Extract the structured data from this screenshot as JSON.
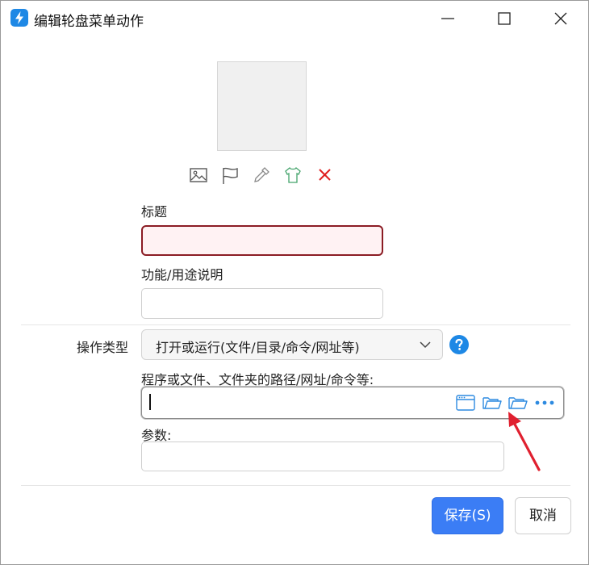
{
  "window": {
    "title": "编辑轮盘菜单动作",
    "controls": [
      "minimize-icon",
      "maximize-icon",
      "close-icon"
    ]
  },
  "icon_tools": [
    "image-icon",
    "flag-icon",
    "eyedropper-icon",
    "shirt-icon",
    "delete-x-icon"
  ],
  "colors": {
    "accent": "#3b7df5",
    "error_border": "#8b1c24",
    "error_bg": "#fff2f3",
    "delete": "#e02020",
    "shirt": "#43a36b",
    "help": "#1e88e5",
    "annotation_arrow": "#e0202f"
  },
  "form": {
    "title_label": "标题",
    "title_value": "",
    "desc_label": "功能/用途说明",
    "desc_value": "",
    "action_type_label": "操作类型",
    "action_type_value": "打开或运行(文件/目录/命令/网址等)",
    "path_label": "程序或文件、文件夹的路径/网址/命令等:",
    "path_value": "",
    "path_icons": [
      "app-window-icon",
      "folder-open-icon",
      "folder-open-icon",
      "more-dots-icon"
    ],
    "params_label": "参数:",
    "params_value": ""
  },
  "buttons": {
    "save_label": "保存(S)",
    "cancel_label": "取消"
  }
}
